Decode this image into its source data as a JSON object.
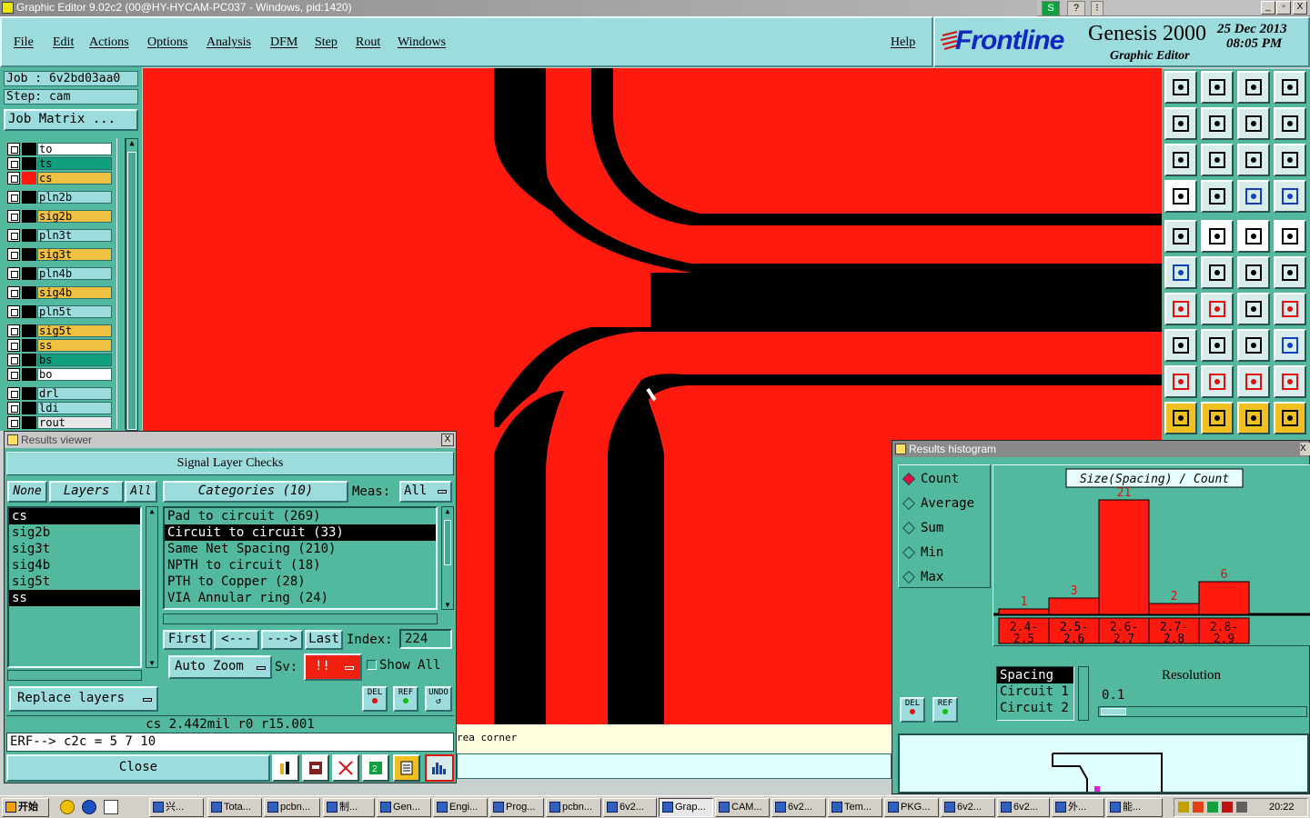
{
  "window": {
    "title": "Graphic Editor 9.02c2 (00@HY-HYCAM-PC037 - Windows, pid:1420)",
    "btn_min": "_",
    "btn_max": "▫",
    "btn_close": "X"
  },
  "menubar": {
    "items": [
      "File",
      "Edit",
      "Actions",
      "Options",
      "Analysis",
      "DFM",
      "Step",
      "Rout",
      "Windows"
    ],
    "help": "Help"
  },
  "brand": {
    "logo": "Frontline",
    "product": "Genesis 2000",
    "subtitle": "Graphic Editor",
    "date": "25 Dec 2013",
    "time": "08:05 PM"
  },
  "job": {
    "job_label": "Job : 6v2bd03aa0",
    "step_label": "Step: cam",
    "matrix_button": "Job Matrix ..."
  },
  "layers": [
    {
      "name": "to",
      "color": "#ffffff",
      "swatch": "#000000"
    },
    {
      "name": "ts",
      "color": "#10a080",
      "swatch": "#000000"
    },
    {
      "name": "cs",
      "color": "#f0c040",
      "swatch": "#ff1a10"
    },
    {
      "name": "pln2b",
      "color": "#9cdcdc",
      "swatch": "#000000"
    },
    {
      "name": "sig2b",
      "color": "#f0c040",
      "swatch": "#000000"
    },
    {
      "name": "pln3t",
      "color": "#9cdcdc",
      "swatch": "#000000"
    },
    {
      "name": "sig3t",
      "color": "#f0c040",
      "swatch": "#000000"
    },
    {
      "name": "pln4b",
      "color": "#9cdcdc",
      "swatch": "#000000"
    },
    {
      "name": "sig4b",
      "color": "#f0c040",
      "swatch": "#000000"
    },
    {
      "name": "pln5t",
      "color": "#9cdcdc",
      "swatch": "#000000"
    },
    {
      "name": "sig5t",
      "color": "#f0c040",
      "swatch": "#000000"
    },
    {
      "name": "ss",
      "color": "#f0c040",
      "swatch": "#000000"
    },
    {
      "name": "bs",
      "color": "#10a080",
      "swatch": "#000000"
    },
    {
      "name": "bo",
      "color": "#ffffff",
      "swatch": "#000000"
    },
    {
      "name": "drl",
      "color": "#9cdcdc",
      "swatch": "#000000"
    },
    {
      "name": "ldi",
      "color": "#9cdcdc",
      "swatch": "#000000"
    },
    {
      "name": "rout",
      "color": "#e8e8e8",
      "swatch": "#000000"
    }
  ],
  "results_viewer": {
    "title": "Results viewer",
    "close_x": "X",
    "header": "Signal Layer Checks",
    "btn_none": "None",
    "btn_layers": "Layers",
    "btn_all": "All",
    "layers": [
      {
        "name": "cs",
        "selected": true
      },
      {
        "name": "sig2b",
        "selected": false
      },
      {
        "name": "sig3t",
        "selected": false
      },
      {
        "name": "sig4b",
        "selected": false
      },
      {
        "name": "sig5t",
        "selected": false
      },
      {
        "name": "ss",
        "selected": true
      }
    ],
    "categories_button": "Categories (10)",
    "meas_label": "Meas:",
    "meas_value": "All",
    "categories": [
      {
        "name": "Pad to circuit (269)",
        "selected": false
      },
      {
        "name": "Circuit to circuit (33)",
        "selected": true
      },
      {
        "name": "Same Net Spacing (210)",
        "selected": false
      },
      {
        "name": "NPTH to circuit (18)",
        "selected": false
      },
      {
        "name": "PTH to Copper (28)",
        "selected": false
      },
      {
        "name": "VIA Annular ring (24)",
        "selected": false
      }
    ],
    "nav_first": "First",
    "nav_prev": "<---",
    "nav_next": "--->",
    "nav_last": "Last",
    "index_label": "Index:",
    "index_value": "224",
    "auto_zoom": "Auto Zoom",
    "sv_label": "Sv:",
    "sv_value": "!!",
    "show_all": "Show All",
    "replace_layers": "Replace layers",
    "del": "DEL",
    "ref": "REF",
    "undo": "UNDO",
    "measurement": "cs 2.442mil  r0  r15.001",
    "erf": "ERF--> c2c = 5 7 10",
    "close": "Close"
  },
  "histogram": {
    "title": "Results histogram",
    "close_x": "X",
    "modes": [
      {
        "label": "Count",
        "selected": true
      },
      {
        "label": "Average",
        "selected": false
      },
      {
        "label": "Sum",
        "selected": false
      },
      {
        "label": "Min",
        "selected": false
      },
      {
        "label": "Max",
        "selected": false
      }
    ],
    "chart_title": "Size(Spacing) / Count",
    "bars": [
      {
        "range_top": "2.4-",
        "range_bottom": "2.5",
        "count": 1
      },
      {
        "range_top": "2.5-",
        "range_bottom": "2.6",
        "count": 3
      },
      {
        "range_top": "2.6-",
        "range_bottom": "2.7",
        "count": 21
      },
      {
        "range_top": "2.7-",
        "range_bottom": "2.8",
        "count": 2
      },
      {
        "range_top": "2.8-",
        "range_bottom": "2.9",
        "count": 6
      }
    ],
    "list": [
      {
        "name": "Spacing",
        "selected": true
      },
      {
        "name": "Circuit 1",
        "selected": false
      },
      {
        "name": "Circuit 2",
        "selected": false
      }
    ],
    "resolution_label": "Resolution",
    "resolution_value": "0.1",
    "del": "DEL",
    "ref": "REF"
  },
  "status": {
    "message": "rea corner"
  },
  "taskbar": {
    "start": "开始",
    "tasks": [
      "兴...",
      "Tota...",
      "pcbn...",
      "制...",
      "Gen...",
      "Engi...",
      "Prog...",
      "pcbn...",
      "6v2...",
      "Grap...",
      "CAM...",
      "6v2...",
      "Tem...",
      "PKG...",
      "6v2...",
      "6v2...",
      "外...",
      "能..."
    ],
    "clock": "20:22"
  },
  "tools": [
    "open-job-tool",
    "save-job-tool",
    "home-tool",
    "window-tool",
    "zoom-back-tool",
    "zoom-forward-tool",
    "step-tool",
    "snap-tool",
    "fit-tool",
    "center-tool",
    "scale-1-2-tool",
    "help-tool",
    "measure-tool",
    "grid-tool",
    "connect-tool",
    "connect-alt-tool",
    "pan-tool",
    "line-tool",
    "ruler-tool",
    "pad-tool",
    "nodes-tool",
    "cross-tool",
    "point-tool",
    "point-alt-tool",
    "angle-tool",
    "slope-tool",
    "arc-tool",
    "flip-tool",
    "add-tool",
    "line-h-tool",
    "center-line-tool",
    "group-tool",
    "triangle-tool",
    "triangle-alt-tool",
    "a-tool",
    "a-alt-tool",
    "select-tool",
    "select-alt-tool",
    "select-box-tool",
    "route-tool"
  ]
}
